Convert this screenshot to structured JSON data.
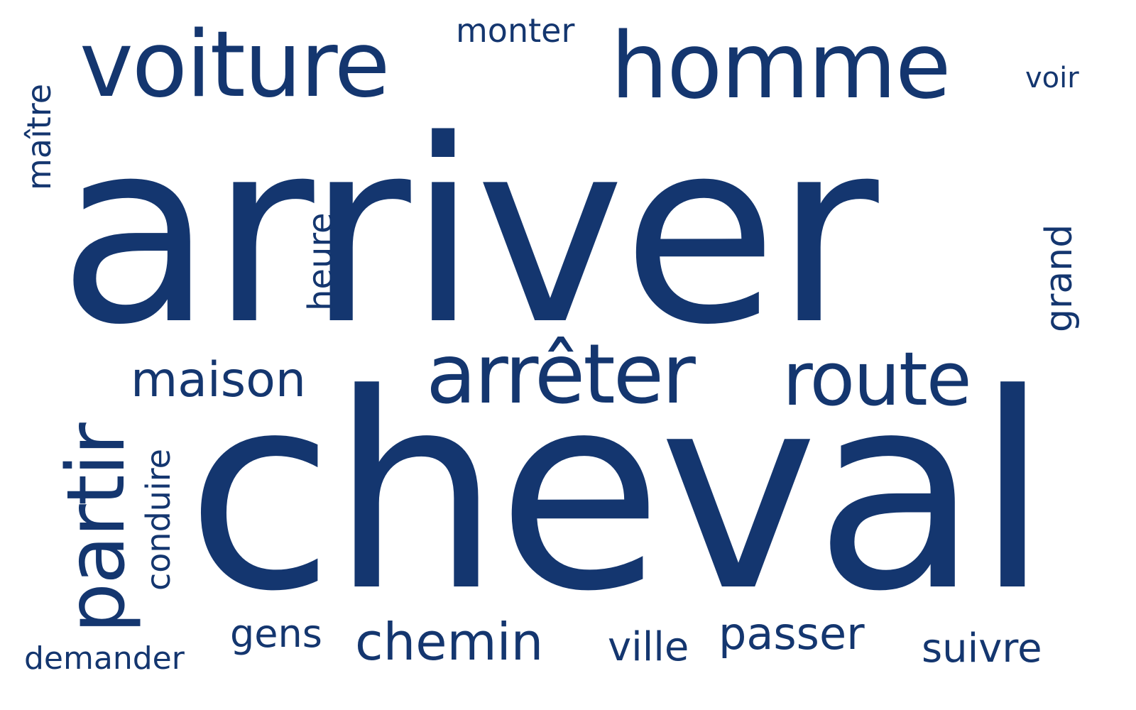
{
  "style": {
    "text_color": "#14366f",
    "background": "#ffffff"
  },
  "words": {
    "arriver": "arriver",
    "cheval": "cheval",
    "voiture": "voiture",
    "homme": "homme",
    "monter": "monter",
    "voir": "voir",
    "arreter": "arrêter",
    "route": "route",
    "maison": "maison",
    "gens": "gens",
    "chemin": "chemin",
    "ville": "ville",
    "passer": "passer",
    "suivre": "suivre",
    "demander": "demander",
    "maitre": "maître",
    "heure": "heure",
    "grand": "grand",
    "partir": "partir",
    "conduire": "conduire"
  }
}
